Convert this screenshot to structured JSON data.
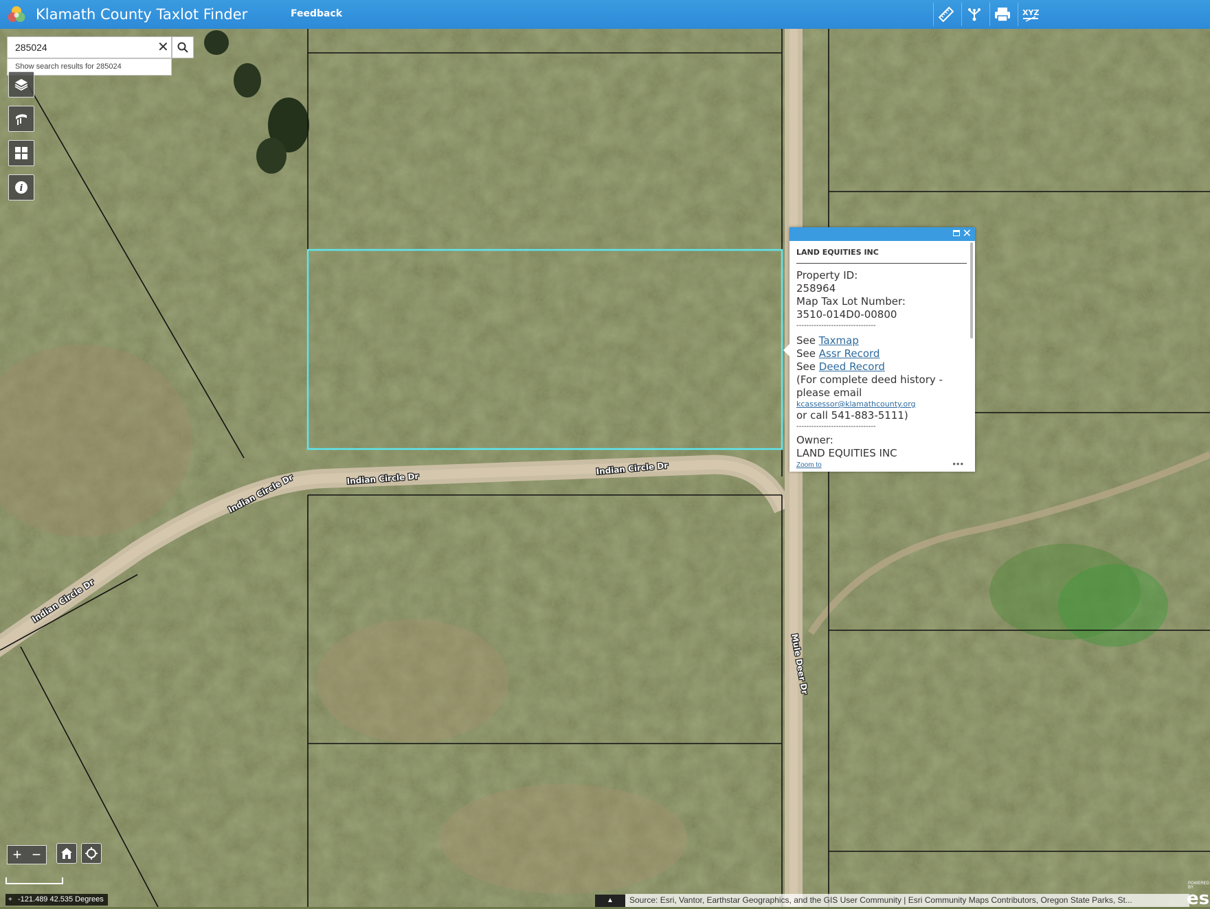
{
  "header": {
    "title": "Klamath County Taxlot Finder",
    "feedback_label": "Feedback",
    "tools": [
      "measure-icon",
      "share-icon",
      "print-icon",
      "xyz-icon"
    ],
    "xyz_label": "XYZ",
    "background_color": "#2d8ad8"
  },
  "search": {
    "value": "285024",
    "suggestion": "Show search results for 285024"
  },
  "left_toolbar": [
    "layers-icon",
    "basemap-icon",
    "grid-icon",
    "info-icon"
  ],
  "map": {
    "road_labels": [
      "Indian Circle Dr",
      "Indian Circle Dr",
      "Indian Circle Dr",
      "Mule Deer Dr"
    ],
    "highlight_color": "#5ee6ee"
  },
  "popup": {
    "title": "LAND EQUITIES INC",
    "property_id_label": "Property ID:",
    "property_id": "258964",
    "map_tax_lot_label": "Map Tax Lot Number:",
    "map_tax_lot": "3510-014D0-00800",
    "divider": "--------------------------------",
    "see": "See",
    "taxmap_link": "Taxmap",
    "assr_link": "Assr Record",
    "deed_link": "Deed Record",
    "history_text": "(For complete deed history - please email",
    "email": "kcassessor@klamathcounty.org",
    "call_text": "or call 541-883-5111)",
    "owner_label": "Owner:",
    "owner": "LAND EQUITIES INC",
    "zoom_to": "Zoom to",
    "more": "•••"
  },
  "footer": {
    "coordinates": "-121.489 42.535 Degrees",
    "attribution": "Source: Esri, Vantor, Earthstar Geographics, and the GIS User Community | Esri Community Maps Contributors, Oregon State Parks, St...",
    "esri_powered": "POWERED BY",
    "esri_logo": "esri"
  }
}
